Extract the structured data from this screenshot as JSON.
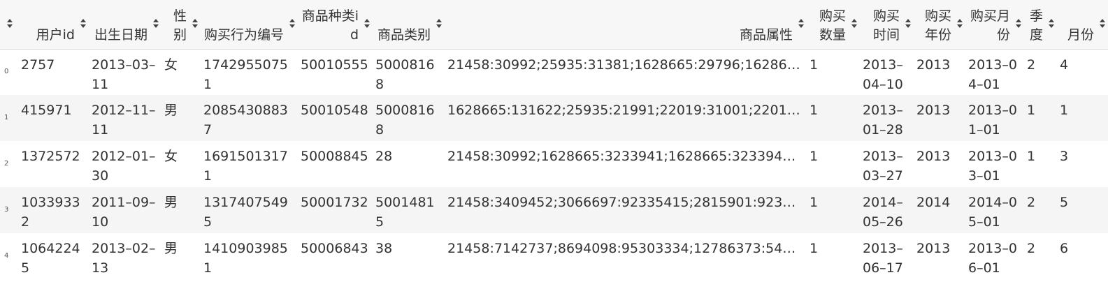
{
  "table": {
    "columns": [
      {
        "key": "index",
        "label": ""
      },
      {
        "key": "user_id",
        "label": "用户id"
      },
      {
        "key": "birth_date",
        "label": "出生日期"
      },
      {
        "key": "gender",
        "label": "性别"
      },
      {
        "key": "purchase_no",
        "label": "购买行为编号"
      },
      {
        "key": "item_type_id",
        "label": "商品种类id"
      },
      {
        "key": "item_category",
        "label": "商品类别"
      },
      {
        "key": "item_attr",
        "label": "商品属性"
      },
      {
        "key": "qty",
        "label": "购买数量"
      },
      {
        "key": "buy_time",
        "label": "购买时间"
      },
      {
        "key": "buy_year",
        "label": "购买年份"
      },
      {
        "key": "buy_month",
        "label": "购买月份"
      },
      {
        "key": "quarter",
        "label": "季度"
      },
      {
        "key": "month",
        "label": "月份"
      }
    ],
    "rows": [
      {
        "index": "0",
        "user_id": "2757",
        "birth_date": "2013–03–11",
        "gender": "女",
        "purchase_no": "17429550751",
        "item_type_id": "50010555",
        "item_category": "50008168",
        "item_attr": "21458:30992;25935:31381;1628665:29796;1628665:...",
        "qty": "1",
        "buy_time": "2013–04–10",
        "buy_year": "2013",
        "buy_month": "2013–04–01",
        "quarter": "2",
        "month": "4"
      },
      {
        "index": "1",
        "user_id": "415971",
        "birth_date": "2012–11–11",
        "gender": "男",
        "purchase_no": "20854308837",
        "item_type_id": "50010548",
        "item_category": "50008168",
        "item_attr": "1628665:131622;25935:21991;22019:31001;22019:3...",
        "qty": "1",
        "buy_time": "2013–01–28",
        "buy_year": "2013",
        "buy_month": "2013–01–01",
        "quarter": "1",
        "month": "1"
      },
      {
        "index": "2",
        "user_id": "1372572",
        "birth_date": "2012–01–30",
        "gender": "女",
        "purchase_no": "16915013171",
        "item_type_id": "50008845",
        "item_category": "28",
        "item_attr": "21458:30992;1628665:3233941;1628665:3233942;16...",
        "qty": "1",
        "buy_time": "2013–03–27",
        "buy_year": "2013",
        "buy_month": "2013–03–01",
        "quarter": "1",
        "month": "3"
      },
      {
        "index": "3",
        "user_id": "10339332",
        "birth_date": "2011–09–10",
        "gender": "男",
        "purchase_no": "13174075495",
        "item_type_id": "50001732",
        "item_category": "50014815",
        "item_attr": "21458:3409452;3066697:92335415;2815901:9233541...",
        "qty": "1",
        "buy_time": "2014–05–26",
        "buy_year": "2014",
        "buy_month": "2014–05–01",
        "quarter": "2",
        "month": "5"
      },
      {
        "index": "4",
        "user_id": "10642245",
        "birth_date": "2013–02–13",
        "gender": "男",
        "purchase_no": "14109039851",
        "item_type_id": "50006843",
        "item_category": "38",
        "item_attr": "21458:7142737;8694098:95303334;12786373:54223;...",
        "qty": "1",
        "buy_time": "2013–06–17",
        "buy_year": "2013",
        "buy_month": "2013–06–01",
        "quarter": "2",
        "month": "6"
      }
    ]
  }
}
